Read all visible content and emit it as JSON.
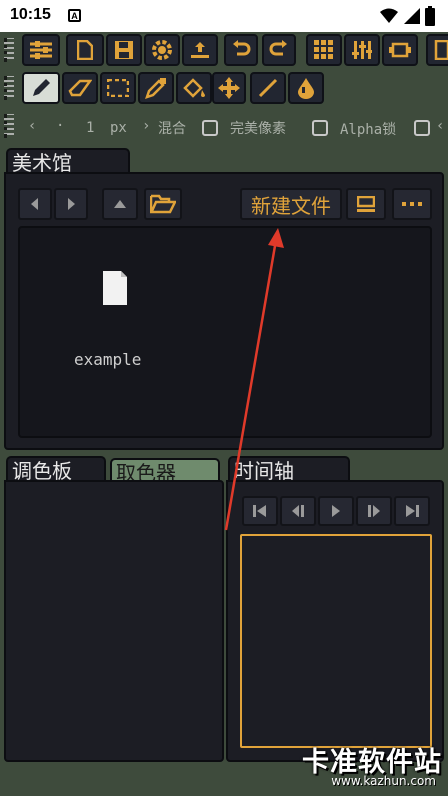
{
  "status_bar": {
    "time": "10:15",
    "app_badge": "A"
  },
  "options": {
    "size_value": "1",
    "size_unit": "px",
    "blend_label": "混合",
    "pixel_perfect_label": "完美像素",
    "alpha_lock_label": "Alpha锁"
  },
  "gallery": {
    "tab_label": "美术馆",
    "new_file_label": "新建文件",
    "files": [
      {
        "name": "example"
      }
    ]
  },
  "palette_tab": "调色板",
  "picker_tab": "取色器",
  "timeline_tab": "时间轴",
  "watermark": {
    "text": "卡准软件站",
    "url": "www.kazhun.com"
  },
  "colors": {
    "accent": "#e0a33a",
    "panel": "#1c1d24",
    "background": "#3e4b3c"
  }
}
